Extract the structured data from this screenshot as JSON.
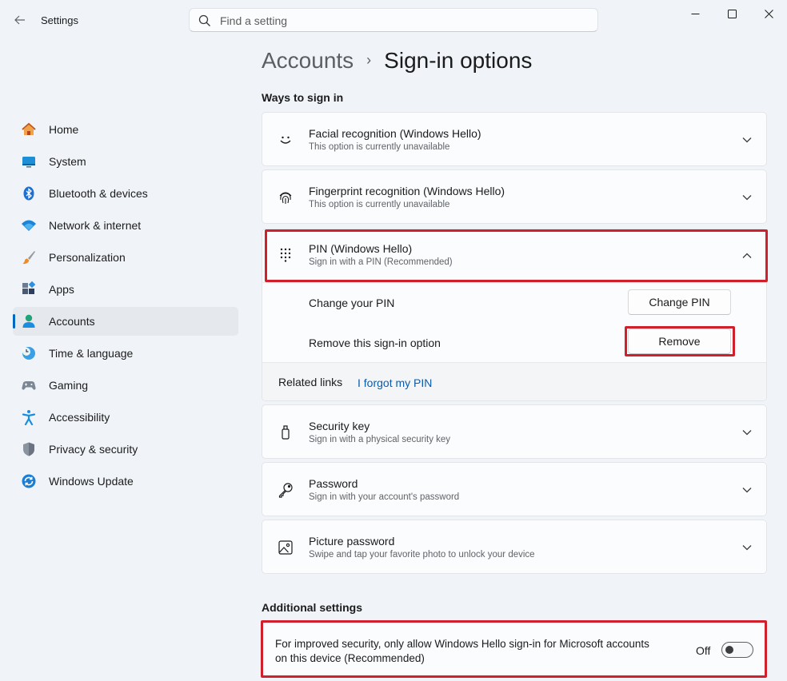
{
  "app": {
    "title": "Settings"
  },
  "search": {
    "placeholder": "Find a setting"
  },
  "sidebar": {
    "items": [
      {
        "label": "Home",
        "icon": "home-icon"
      },
      {
        "label": "System",
        "icon": "system-icon"
      },
      {
        "label": "Bluetooth & devices",
        "icon": "bluetooth-icon"
      },
      {
        "label": "Network & internet",
        "icon": "wifi-icon"
      },
      {
        "label": "Personalization",
        "icon": "brush-icon"
      },
      {
        "label": "Apps",
        "icon": "apps-icon"
      },
      {
        "label": "Accounts",
        "icon": "person-icon",
        "active": true
      },
      {
        "label": "Time & language",
        "icon": "globe-clock-icon"
      },
      {
        "label": "Gaming",
        "icon": "gamepad-icon"
      },
      {
        "label": "Accessibility",
        "icon": "accessibility-icon"
      },
      {
        "label": "Privacy & security",
        "icon": "shield-icon"
      },
      {
        "label": "Windows Update",
        "icon": "update-icon"
      }
    ]
  },
  "breadcrumb": {
    "parent": "Accounts",
    "separator": "›",
    "current": "Sign-in options"
  },
  "ways": {
    "heading": "Ways to sign in",
    "facial": {
      "title": "Facial recognition (Windows Hello)",
      "subtitle": "This option is currently unavailable"
    },
    "fingerprint": {
      "title": "Fingerprint recognition (Windows Hello)",
      "subtitle": "This option is currently unavailable"
    },
    "pin": {
      "title": "PIN (Windows Hello)",
      "subtitle": "Sign in with a PIN (Recommended)",
      "change_label": "Change your PIN",
      "change_button": "Change PIN",
      "remove_label": "Remove this sign-in option",
      "remove_button": "Remove",
      "related_label": "Related links",
      "forgot_link": "I forgot my PIN"
    },
    "security_key": {
      "title": "Security key",
      "subtitle": "Sign in with a physical security key"
    },
    "password": {
      "title": "Password",
      "subtitle": "Sign in with your account's password"
    },
    "picture_password": {
      "title": "Picture password",
      "subtitle": "Swipe and tap your favorite photo to unlock your device"
    }
  },
  "additional": {
    "heading": "Additional settings",
    "hello_only": {
      "line1": "For improved security, only allow Windows Hello sign-in for Microsoft accounts",
      "line2": "on this device (Recommended)",
      "state_label": "Off",
      "enabled": false
    }
  },
  "colors": {
    "accent": "#0067c0",
    "highlight": "#d0202b",
    "link": "#0b5cad"
  }
}
